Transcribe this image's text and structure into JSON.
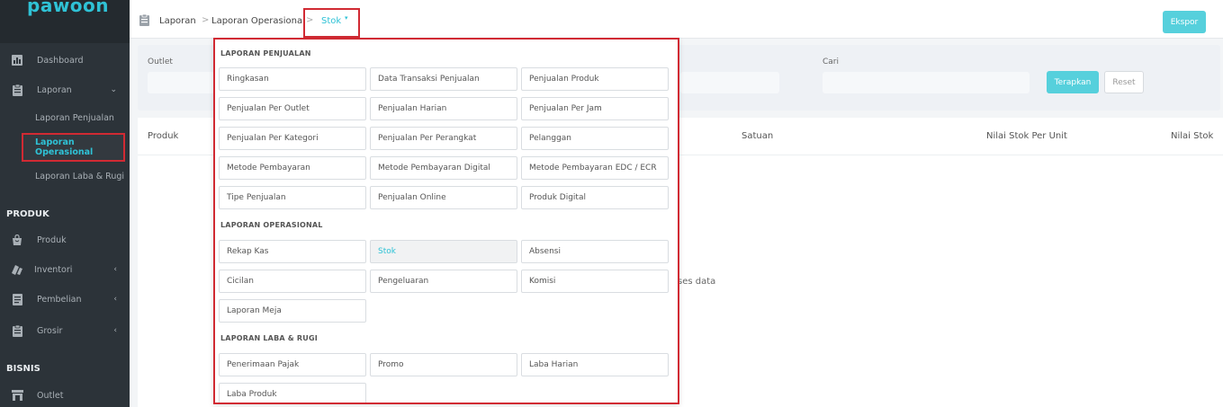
{
  "brand": {
    "logo_text": "pawoon",
    "accent": "#2fc2d6"
  },
  "sidebar": {
    "items": [
      {
        "label": "Dashboard",
        "icon": "chart-icon"
      },
      {
        "label": "Laporan",
        "icon": "clipboard-icon",
        "chevron": "⌄"
      }
    ],
    "sub_items": [
      {
        "label": "Laporan Penjualan"
      },
      {
        "label": "Laporan Operasional"
      },
      {
        "label": "Laporan Laba & Rugi"
      }
    ],
    "section_produk": "PRODUK",
    "produk_items": [
      {
        "label": "Produk",
        "icon": "bag-icon"
      },
      {
        "label": "Inventori",
        "icon": "box-icon",
        "chevron": "‹"
      },
      {
        "label": "Pembelian",
        "icon": "document-icon",
        "chevron": "‹"
      },
      {
        "label": "Grosir",
        "icon": "clipboard-icon",
        "chevron": "‹"
      }
    ],
    "section_bisnis": "BISNIS",
    "bisnis_items": [
      {
        "label": "Outlet",
        "icon": "store-icon"
      }
    ]
  },
  "header": {
    "breadcrumb": [
      "Laporan",
      "Laporan Operasional",
      "Stok"
    ],
    "separator": ">",
    "caret": "▾",
    "export_label": "Ekspor"
  },
  "filter": {
    "outlet_label": "Outlet",
    "search_label": "Cari",
    "apply_label": "Terapkan",
    "reset_label": "Reset"
  },
  "table": {
    "columns": [
      "Produk",
      "Satuan",
      "Nilai Stok Per Unit",
      "Nilai Stok"
    ],
    "empty_text": "ses data"
  },
  "dropdown": {
    "sections": [
      {
        "title": "LAPORAN PENJUALAN",
        "items": [
          "Ringkasan",
          "Data Transaksi Penjualan",
          "Penjualan Produk",
          "Penjualan Per Outlet",
          "Penjualan Harian",
          "Penjualan Per Jam",
          "Penjualan Per Kategori",
          "Penjualan Per Perangkat",
          "Pelanggan",
          "Metode Pembayaran",
          "Metode Pembayaran Digital",
          "Metode Pembayaran EDC / ECR",
          "Tipe Penjualan",
          "Penjualan Online",
          "Produk Digital"
        ]
      },
      {
        "title": "LAPORAN OPERASIONAL",
        "items": [
          "Rekap Kas",
          "Stok",
          "Absensi",
          "Cicilan",
          "Pengeluaran",
          "Komisi",
          "Laporan Meja"
        ]
      },
      {
        "title": "LAPORAN LABA & RUGI",
        "items": [
          "Penerimaan Pajak",
          "Promo",
          "Laba Harian",
          "Laba Produk"
        ]
      }
    ],
    "selected": "Stok"
  }
}
